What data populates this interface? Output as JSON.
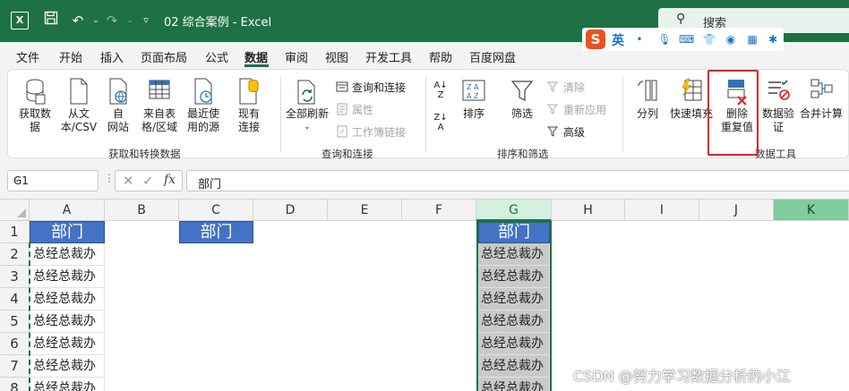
{
  "titlebar": {
    "logo": "X",
    "file_title": "02 综合案例 - Excel",
    "search_label": "搜索"
  },
  "ime": {
    "logo": "S",
    "mode": "英"
  },
  "menu": {
    "items": [
      "文件",
      "开始",
      "插入",
      "页面布局",
      "公式",
      "数据",
      "审阅",
      "视图",
      "开发工具",
      "帮助",
      "百度网盘"
    ],
    "active": "数据"
  },
  "ribbon": {
    "get_data": {
      "get_data": "获取数\n据",
      "from_text_csv": "从文\n本/CSV",
      "from_web": "自\n网站",
      "from_table": "来自表\n格/区域",
      "recent_sources": "最近使\n用的源",
      "existing_conn": "现有\n连接",
      "group_label": "获取和转换数据"
    },
    "queries": {
      "refresh_all": "全部刷新",
      "queries_conn": "查询和连接",
      "properties": "属性",
      "edit_links": "工作簿链接",
      "group_label": "查询和连接"
    },
    "sort_filter": {
      "sort": "排序",
      "filter": "筛选",
      "clear": "清除",
      "reapply": "重新应用",
      "advanced": "高级",
      "group_label": "排序和筛选"
    },
    "data_tools": {
      "text_to_columns": "分列",
      "flash_fill": "快速填充",
      "remove_duplicates": "删除\n重复值",
      "data_validation": "数据验\n证",
      "consolidate": "合并计算",
      "group_label": "数据工具"
    }
  },
  "formula_bar": {
    "name_box": "G1",
    "content": "部门"
  },
  "grid": {
    "columns": [
      "A",
      "B",
      "C",
      "D",
      "E",
      "F",
      "G",
      "H",
      "I",
      "J",
      "K"
    ],
    "rows": [
      "1",
      "2",
      "3",
      "4",
      "5",
      "6",
      "7",
      "8"
    ],
    "header_text": "部门",
    "cell_text": "总经总裁办",
    "selected_column": "G"
  },
  "watermark": "CSDN @努力学习数据分析的小江"
}
